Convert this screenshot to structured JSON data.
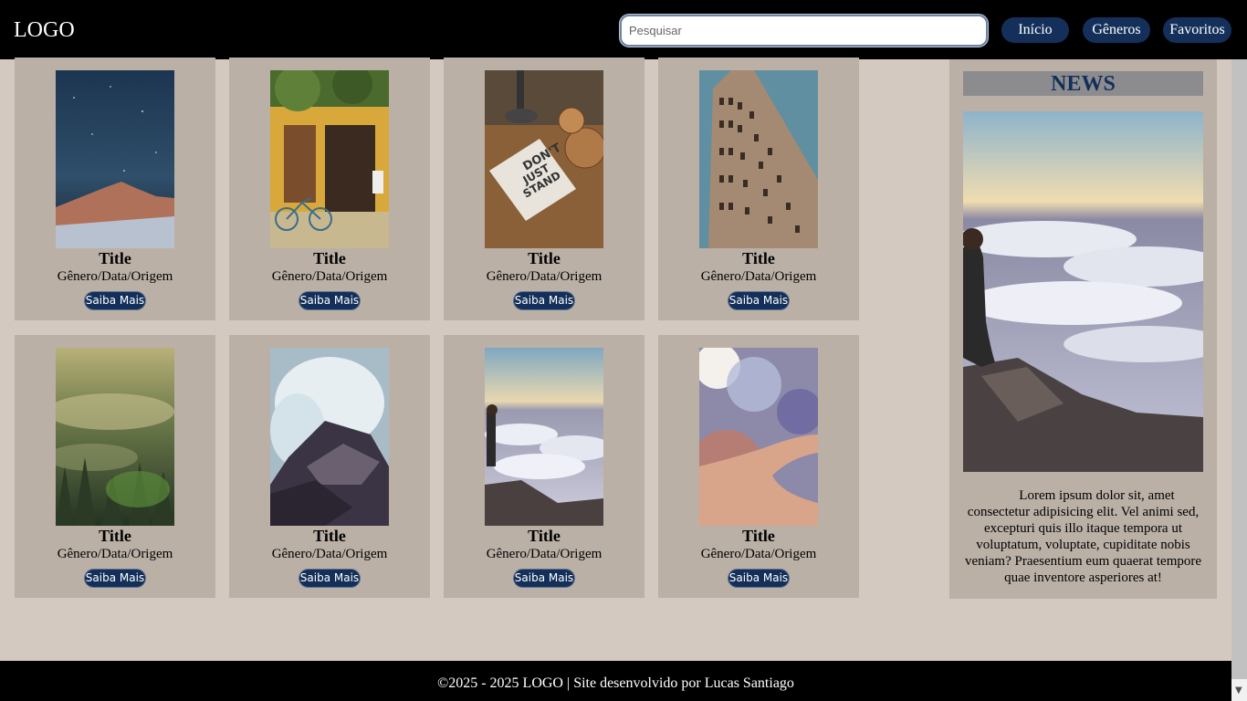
{
  "header": {
    "logo": "LOGO",
    "search": {
      "placeholder": "Pesquisar",
      "value": ""
    },
    "nav": [
      {
        "label": "Início"
      },
      {
        "label": "Gêneros"
      },
      {
        "label": "Favoritos"
      }
    ]
  },
  "cards": [
    {
      "title": "Title",
      "meta": "Gênero/Data/Origem",
      "button": "Saiba Mais",
      "image": "starry-mountain-night"
    },
    {
      "title": "Title",
      "meta": "Gênero/Data/Origem",
      "button": "Saiba Mais",
      "image": "yellow-house-bicycle"
    },
    {
      "title": "Title",
      "meta": "Gênero/Data/Origem",
      "button": "Saiba Mais",
      "image": "dont-just-stand-there-notebook"
    },
    {
      "title": "Title",
      "meta": "Gênero/Data/Origem",
      "button": "Saiba Mais",
      "image": "flatiron-building"
    },
    {
      "title": "Title",
      "meta": "Gênero/Data/Origem",
      "button": "Saiba Mais",
      "image": "misty-forest"
    },
    {
      "title": "Title",
      "meta": "Gênero/Data/Origem",
      "button": "Saiba Mais",
      "image": "waves-on-rocks"
    },
    {
      "title": "Title",
      "meta": "Gênero/Data/Origem",
      "button": "Saiba Mais",
      "image": "person-above-clouds"
    },
    {
      "title": "Title",
      "meta": "Gênero/Data/Origem",
      "button": "Saiba Mais",
      "image": "pointing-hand-bokeh"
    }
  ],
  "news": {
    "heading": "NEWS",
    "image": "person-above-clouds",
    "text": "Lorem ipsum dolor sit, amet consectetur adipisicing elit. Vel animi sed, excepturi quis illo itaque tempora ut voluptatum, voluptate, cupiditate nobis veniam? Praesentium eum quaerat tempore quae inventore asperiores at!"
  },
  "footer": {
    "text": "©2025 - 2025 LOGO | Site desenvolvido por Lucas Santiago"
  },
  "colors": {
    "header_bg": "#000000",
    "page_bg": "#d3c9c0",
    "card_bg": "#bbb0a6",
    "accent": "#14305a",
    "news_heading_bg": "#8c8c8e"
  }
}
